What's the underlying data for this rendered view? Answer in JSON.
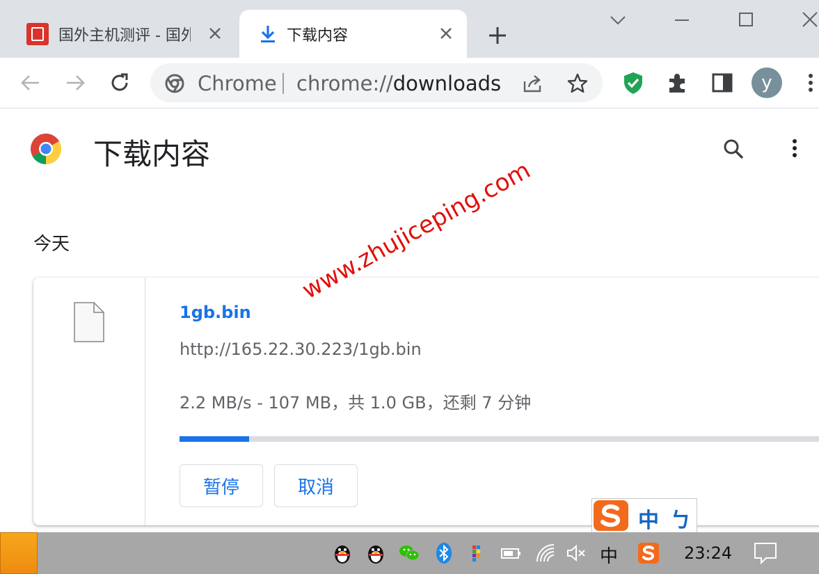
{
  "tabs": [
    {
      "title": "国外主机测评 - 国外",
      "active": false
    },
    {
      "title": "下载内容",
      "active": true
    }
  ],
  "omnibox": {
    "chrome_label": "Chrome",
    "url_prefix": "chrome://",
    "url_path": "downloads"
  },
  "profile": {
    "initial": "y"
  },
  "page": {
    "title": "下载内容",
    "section": "今天"
  },
  "download": {
    "file_name": "1gb.bin",
    "url": "http://165.22.30.223/1gb.bin",
    "status": "2.2 MB/s - 107 MB，共 1.0 GB，还剩 7 分钟",
    "progress_fraction": 0.105,
    "pause_label": "暂停",
    "cancel_label": "取消"
  },
  "watermark": "www.zhujiceping.com",
  "ime": {
    "mode": "中",
    "punct": "ㄅ"
  },
  "taskbar": {
    "clock": "23:24",
    "ime_indicator": "中"
  },
  "colors": {
    "accent": "#1a73e8",
    "tabstrip": "#dee1e6",
    "taskbar": "#a7a7a7",
    "watermark": "#e0100b"
  }
}
